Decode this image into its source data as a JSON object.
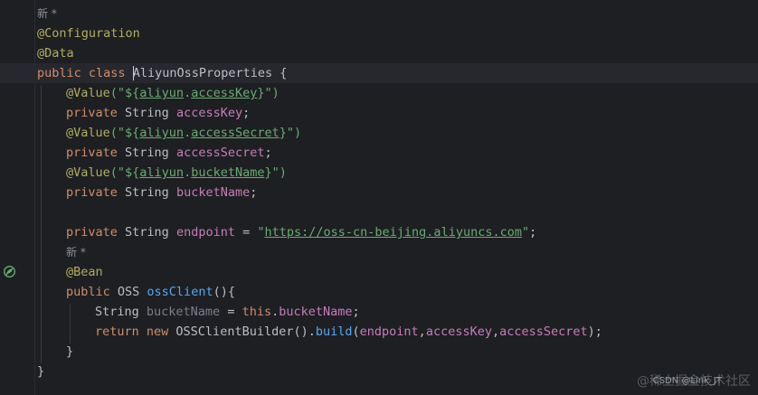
{
  "editor": {
    "lines": [
      {
        "hint": "新 *"
      },
      {
        "annotation": "@Configuration"
      },
      {
        "annotation": "@Data"
      },
      {
        "kw1": "public",
        "kw2": "class",
        "class_name": "AliyunOssProperties",
        "brace": " {"
      },
      {
        "annotation": "@Value",
        "open": "(\"${",
        "prop_a": "aliyun",
        "dot": ".",
        "prop_b": "accessKey",
        "close": "}\")"
      },
      {
        "kw": "private",
        "type": " String ",
        "name": "accessKey",
        "end": ";"
      },
      {
        "annotation": "@Value",
        "open": "(\"${",
        "prop_a": "aliyun",
        "dot": ".",
        "prop_b": "accessSecret",
        "close": "}\")"
      },
      {
        "kw": "private",
        "type": " String ",
        "name": "accessSecret",
        "end": ";"
      },
      {
        "annotation": "@Value",
        "open": "(\"${",
        "prop_a": "aliyun",
        "dot": ".",
        "prop_b": "bucketName",
        "close": "}\")"
      },
      {
        "kw": "private",
        "type": " String ",
        "name": "bucketName",
        "end": ";"
      },
      {},
      {
        "kw": "private",
        "type": " String ",
        "name": "endpoint",
        "eq": " = ",
        "q1": "\"",
        "url": "https://oss-cn-beijing.aliyuncs.com",
        "q2": "\"",
        "end": ";"
      },
      {
        "hint": "新 *"
      },
      {
        "annotation": "@Bean"
      },
      {
        "kw": "public",
        "type": " OSS ",
        "method": "ossClient",
        "rest": "(){"
      },
      {
        "type": "String ",
        "local": "bucketName",
        "eq": " = ",
        "this_kw": "this",
        "dot": ".",
        "field": "bucketName",
        "end": ";"
      },
      {
        "kw1": "return",
        "kw2": " new ",
        "cls": "OSSClientBuilder",
        "call1": "().",
        "method": "build",
        "args_open": "(",
        "a1": "endpoint",
        "c1": ",",
        "a2": "accessKey",
        "c2": ",",
        "a3": "accessSecret",
        "args_close": ");"
      },
      {
        "brace": "}"
      },
      {
        "brace": "}"
      }
    ]
  },
  "icons": {
    "bean_gutter": "spring-bean-icon"
  },
  "watermark": {
    "text": "@稀土掘金技术社区",
    "csdn": "CSDN @Link_JT"
  },
  "colors": {
    "background": "#1e1f22",
    "keyword": "#cf8e6d",
    "annotation": "#b3ae60",
    "string": "#6aab73",
    "field": "#c77dbb",
    "method": "#56a8f5"
  }
}
